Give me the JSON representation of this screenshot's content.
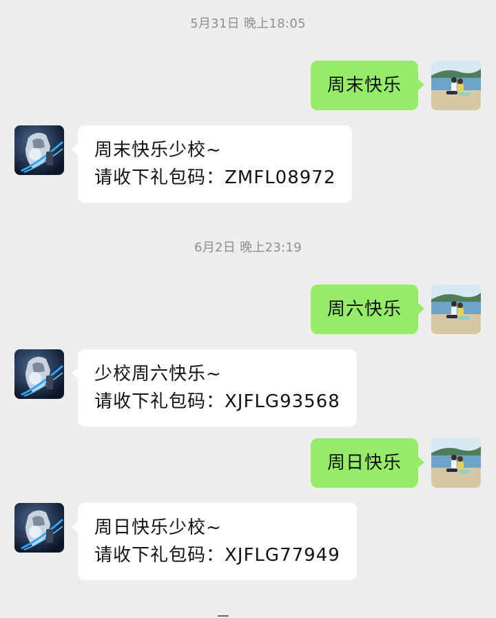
{
  "chat": {
    "groups": [
      {
        "timestamp": "5月31日 晚上18:05",
        "sent": "周末快乐",
        "reply_line1": "周末快乐少校~",
        "reply_line2": "请收下礼包码：ZMFL08972"
      },
      {
        "timestamp": "6月2日 晚上23:19",
        "sent": "周六快乐",
        "reply_line1": "少校周六快乐~",
        "reply_line2": "请收下礼包码：XJFLG93568"
      },
      {
        "sent": "周日快乐",
        "reply_line1": "周日快乐少校~",
        "reply_line2": "请收下礼包码：XJFLG77949"
      }
    ]
  },
  "colors": {
    "background": "#ededed",
    "outgoing_bubble": "#95ec69",
    "incoming_bubble": "#ffffff",
    "timestamp_text": "#8e8e8e"
  },
  "icons": {
    "user_avatar": "beach-couple-photo-avatar",
    "bot_avatar": "armored-robot-avatar"
  }
}
